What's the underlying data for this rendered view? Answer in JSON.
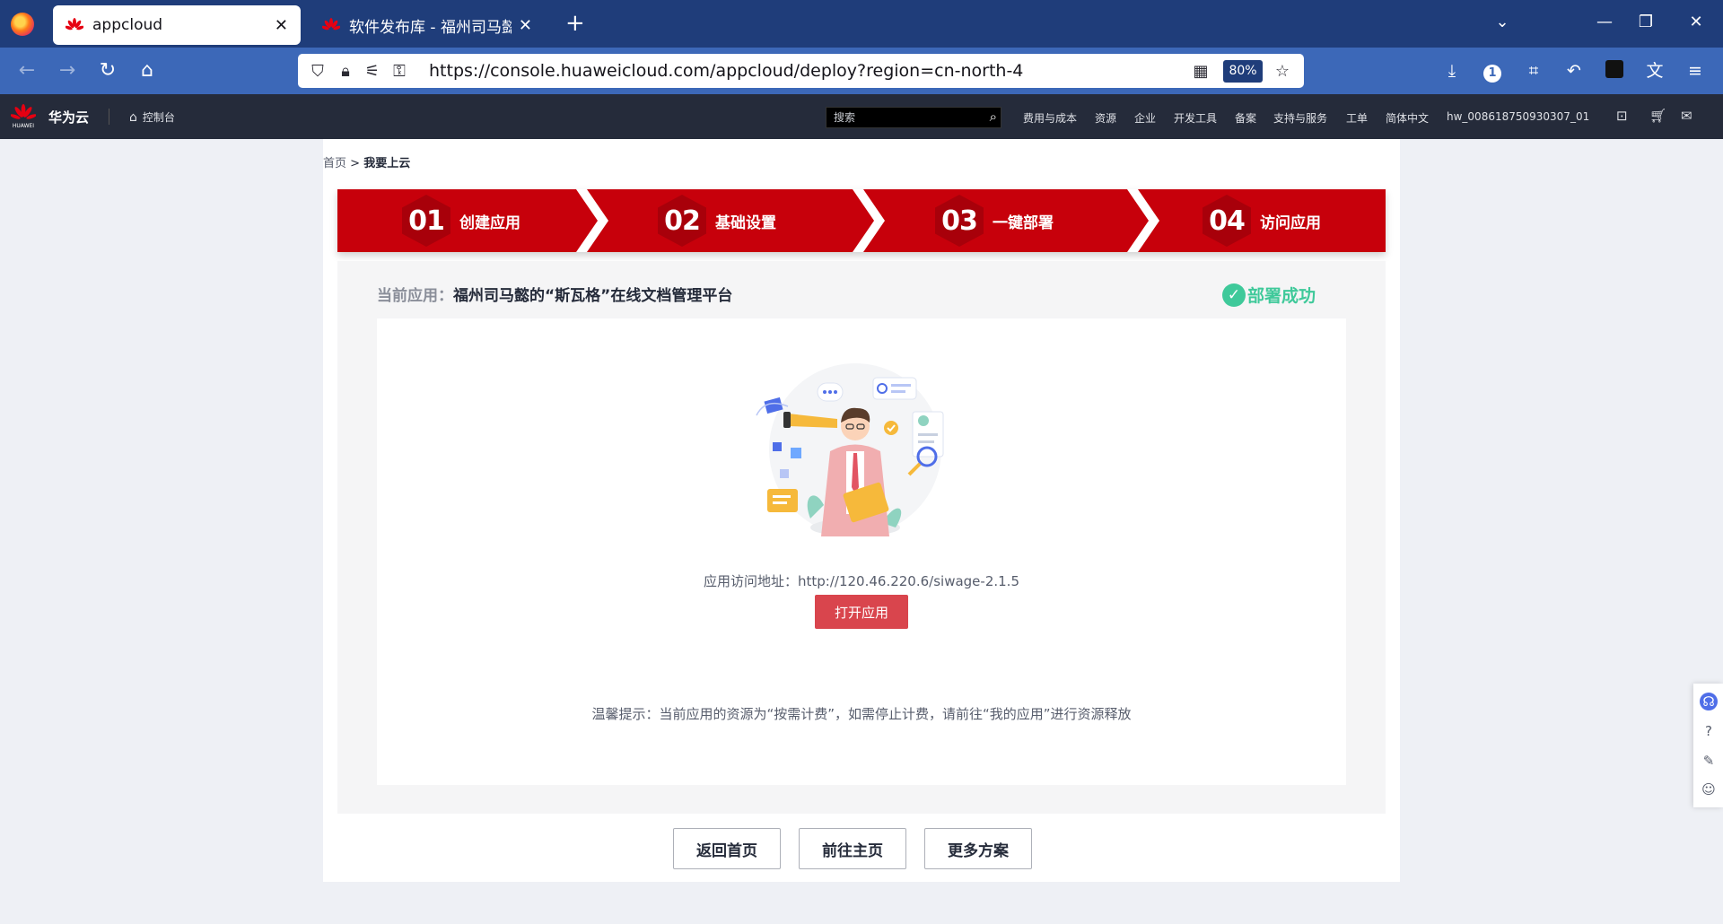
{
  "browser": {
    "tabs": [
      {
        "title": "appcloud",
        "active": true
      },
      {
        "title": "软件发布库 - 福州司马懿的“斯瓦",
        "active": false
      }
    ],
    "url": "https://console.huaweicloud.com/appcloud/deploy?region=cn-north-4",
    "zoom": "80%",
    "extension_badge": "1"
  },
  "header": {
    "logo_text": "HUAWEI",
    "brand": "华为云",
    "console": "控制台",
    "search_placeholder": "搜索",
    "nav": [
      "费用与成本",
      "资源",
      "企业",
      "开发工具",
      "备案",
      "支持与服务",
      "工单",
      "简体中文",
      "hw_008618750930307_01"
    ]
  },
  "breadcrumb": {
    "home": "首页",
    "separator": ">",
    "current": "我要上云"
  },
  "steps": [
    {
      "num": "01",
      "label": "创建应用"
    },
    {
      "num": "02",
      "label": "基础设置"
    },
    {
      "num": "03",
      "label": "一键部署"
    },
    {
      "num": "04",
      "label": "访问应用"
    }
  ],
  "deploy": {
    "app_label": "当前应用：",
    "app_name": "福州司马懿的“斯瓦格”在线文档管理平台",
    "status": "部署成功",
    "access_label": "应用访问地址：",
    "access_url": "http://120.46.220.6/siwage-2.1.5",
    "open_button": "打开应用",
    "tip": "温馨提示：当前应用的资源为“按需计费”，如需停止计费，请前往“我的应用”进行资源释放"
  },
  "bottom_buttons": [
    "返回首页",
    "前往主页",
    "更多方案"
  ],
  "colors": {
    "brand_red": "#c7000b",
    "success_green": "#3fc99a",
    "button_red": "#d9454d",
    "header_dark": "#252b3a",
    "browser_blue": "#1f3d7a"
  }
}
